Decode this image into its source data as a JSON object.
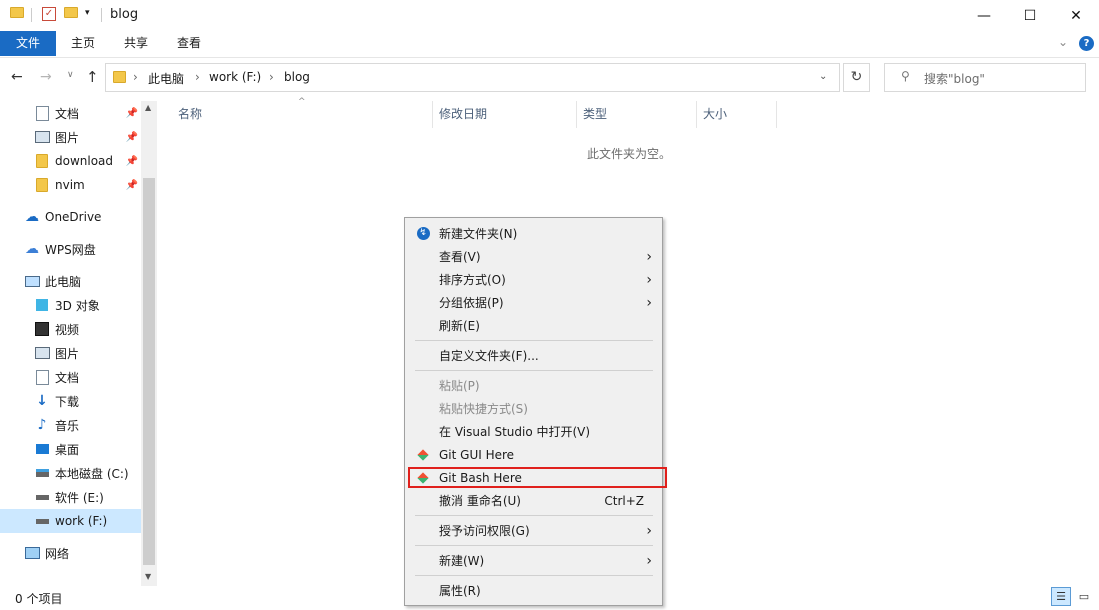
{
  "window": {
    "title": "blog",
    "minimize_glyph": "—",
    "maximize_glyph": "☐",
    "close_glyph": "✕"
  },
  "ribbon": {
    "tabs": [
      "文件",
      "主页",
      "共享",
      "查看"
    ],
    "help_glyph": "?"
  },
  "address": {
    "path": [
      "此电脑",
      "work (F:)",
      "blog"
    ],
    "search_placeholder": "搜索\"blog\""
  },
  "nav": {
    "quick_access": [
      {
        "label": "文档",
        "icon": "document-icon",
        "pinned": true
      },
      {
        "label": "图片",
        "icon": "pictures-icon",
        "pinned": true
      },
      {
        "label": "download",
        "icon": "folder-icon",
        "pinned": true
      },
      {
        "label": "nvim",
        "icon": "folder-icon",
        "pinned": true
      }
    ],
    "onedrive": "OneDrive",
    "wps": "WPS网盘",
    "this_pc": "此电脑",
    "pc_items": [
      {
        "label": "3D 对象",
        "icon": "3d-objects-icon"
      },
      {
        "label": "视频",
        "icon": "videos-icon"
      },
      {
        "label": "图片",
        "icon": "pictures-icon"
      },
      {
        "label": "文档",
        "icon": "document-icon"
      },
      {
        "label": "下载",
        "icon": "download-icon"
      },
      {
        "label": "音乐",
        "icon": "music-icon"
      },
      {
        "label": "桌面",
        "icon": "desktop-icon"
      },
      {
        "label": "本地磁盘 (C:)",
        "icon": "drive-icon"
      },
      {
        "label": "软件 (E:)",
        "icon": "drive-icon"
      },
      {
        "label": "work (F:)",
        "icon": "drive-icon",
        "selected": true
      }
    ],
    "network": "网络"
  },
  "content": {
    "columns": [
      "名称",
      "修改日期",
      "类型",
      "大小"
    ],
    "empty_text": "此文件夹为空。"
  },
  "context_menu": {
    "items": [
      {
        "label": "新建文件夹(N)",
        "icon": "new-folder-icon"
      },
      {
        "label": "查看(V)",
        "submenu": true
      },
      {
        "label": "排序方式(O)",
        "submenu": true
      },
      {
        "label": "分组依据(P)",
        "submenu": true
      },
      {
        "label": "刷新(E)"
      },
      {
        "label": "自定义文件夹(F)..."
      },
      {
        "label": "粘贴(P)",
        "disabled": true
      },
      {
        "label": "粘贴快捷方式(S)",
        "disabled": true
      },
      {
        "label": "在 Visual Studio 中打开(V)"
      },
      {
        "label": "Git GUI Here",
        "icon": "git-icon"
      },
      {
        "label": "Git Bash Here",
        "icon": "git-icon",
        "highlighted": true
      },
      {
        "label": "撤消 重命名(U)",
        "accelerator": "Ctrl+Z"
      },
      {
        "label": "授予访问权限(G)",
        "submenu": true
      },
      {
        "label": "新建(W)",
        "submenu": true
      },
      {
        "label": "属性(R)"
      }
    ]
  },
  "status": {
    "item_count": "0 个项目"
  },
  "colors": {
    "accent": "#1a6bc4",
    "highlight_border": "#e0201c",
    "selection": "#cce8ff"
  }
}
